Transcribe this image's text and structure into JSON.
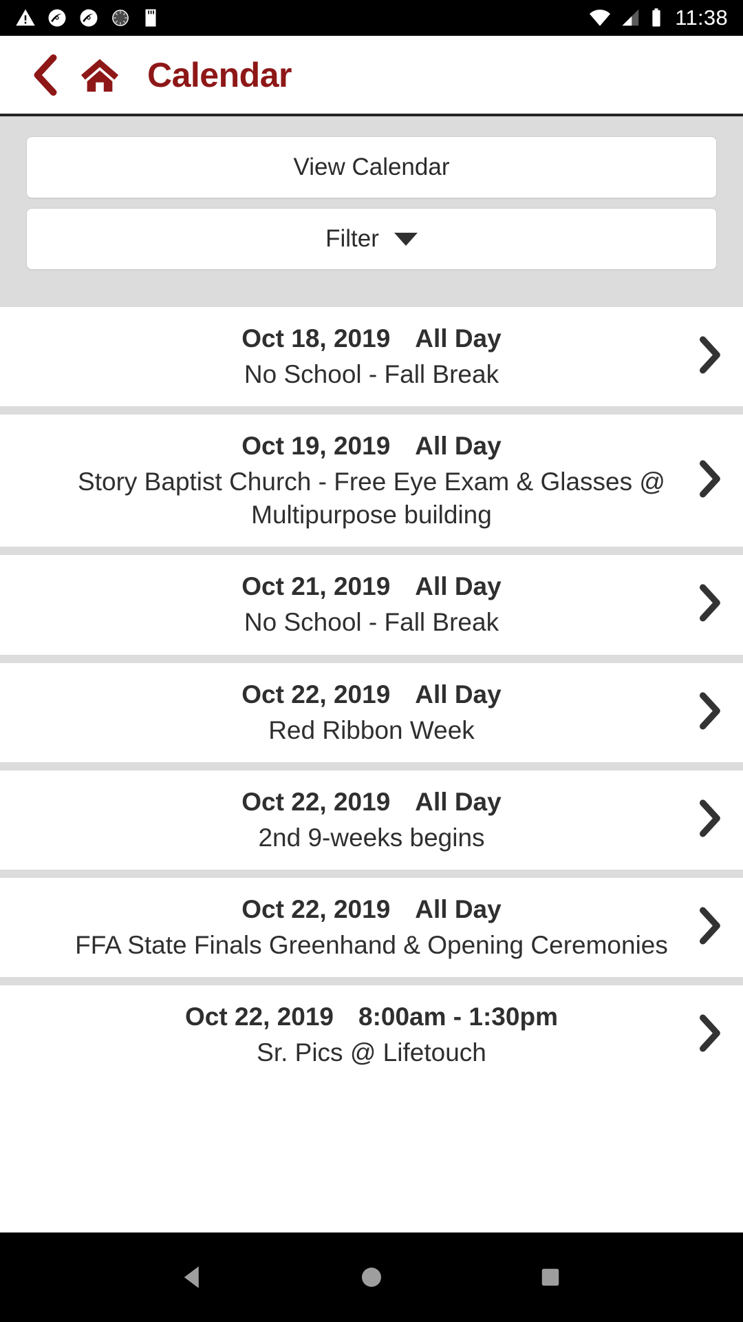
{
  "status_bar": {
    "time": "11:38",
    "left_icons": [
      "warning-triangle-icon",
      "sync-icon",
      "sync-icon",
      "loading-spinner-icon",
      "sd-card-icon"
    ],
    "right_icons": [
      "wifi-icon",
      "cellular-signal-icon",
      "battery-icon"
    ]
  },
  "header": {
    "title": "Calendar",
    "back_icon": "back-chevron-icon",
    "home_icon": "home-icon",
    "accent_color": "#8e1717"
  },
  "toolbar": {
    "view_calendar_label": "View Calendar",
    "filter_label": "Filter",
    "filter_caret_icon": "caret-down-icon",
    "background_color": "#dcdcdc"
  },
  "events": [
    {
      "date": "Oct 18, 2019",
      "time": "All Day",
      "title": "No School - Fall Break"
    },
    {
      "date": "Oct 19, 2019",
      "time": "All Day",
      "title": "Story Baptist Church - Free Eye Exam & Glasses @ Multipurpose building"
    },
    {
      "date": "Oct 21, 2019",
      "time": "All Day",
      "title": "No School - Fall Break"
    },
    {
      "date": "Oct 22, 2019",
      "time": "All Day",
      "title": "Red Ribbon Week"
    },
    {
      "date": "Oct 22, 2019",
      "time": "All Day",
      "title": "2nd 9-weeks begins"
    },
    {
      "date": "Oct 22, 2019",
      "time": "All Day",
      "title": "FFA State Finals Greenhand & Opening Ceremonies"
    },
    {
      "date": "Oct 22, 2019",
      "time": "8:00am - 1:30pm",
      "title": "Sr. Pics @ Lifetouch"
    }
  ],
  "nav_bar": {
    "back_icon": "nav-back-triangle-icon",
    "home_icon": "nav-home-circle-icon",
    "recents_icon": "nav-recents-square-icon",
    "icon_color": "#9e9e9e"
  }
}
